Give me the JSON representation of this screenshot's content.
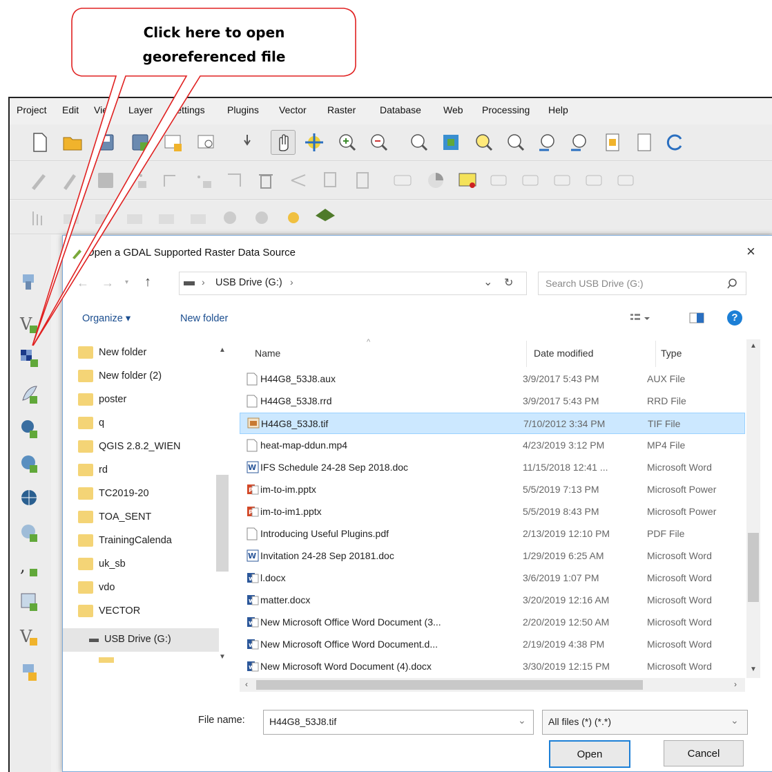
{
  "callout": {
    "line1": "Click here to open",
    "line2": "georeferenced file"
  },
  "menu": [
    "Project",
    "Edit",
    "View",
    "Layer",
    "Settings",
    "Plugins",
    "Vector",
    "Raster",
    "Database",
    "Web",
    "Processing",
    "Help"
  ],
  "dialog": {
    "title": "Open a GDAL Supported Raster Data Source",
    "close_glyph": "×",
    "address": {
      "drive_label": "USB Drive (G:)",
      "separator": "›",
      "dropdown": "⌄"
    },
    "search_placeholder": "Search USB Drive (G:)",
    "organize": "Organize ▾",
    "new_folder": "New folder",
    "nav_items": [
      "New folder",
      "New folder (2)",
      "poster",
      "q",
      "QGIS 2.8.2_WIEN",
      "rd",
      "TC2019-20",
      "TOA_SENT",
      "TrainingCalenda",
      "uk_sb",
      "vdo",
      "VECTOR"
    ],
    "nav_drive": "USB Drive (G:)",
    "columns": {
      "name": "Name",
      "date": "Date modified",
      "type": "Type"
    },
    "files": [
      {
        "name": "H44G8_53J8.aux",
        "date": "3/9/2017 5:43 PM",
        "type": "AUX File",
        "icon": "blank-file-icon"
      },
      {
        "name": "H44G8_53J8.rrd",
        "date": "3/9/2017 5:43 PM",
        "type": "RRD File",
        "icon": "blank-file-icon"
      },
      {
        "name": "H44G8_53J8.tif",
        "date": "7/10/2012 3:34 PM",
        "type": "TIF File",
        "icon": "image-file-icon",
        "selected": true
      },
      {
        "name": "heat-map-ddun.mp4",
        "date": "4/23/2019 3:12 PM",
        "type": "MP4 File",
        "icon": "blank-file-icon"
      },
      {
        "name": "IFS Schedule 24-28 Sep 2018.doc",
        "date": "11/15/2018 12:41 ...",
        "type": "Microsoft Word",
        "icon": "word-doc-icon"
      },
      {
        "name": "im-to-im.pptx",
        "date": "5/5/2019 7:13 PM",
        "type": "Microsoft Power",
        "icon": "powerpoint-icon"
      },
      {
        "name": "im-to-im1.pptx",
        "date": "5/5/2019 8:43 PM",
        "type": "Microsoft Power",
        "icon": "powerpoint-icon"
      },
      {
        "name": "Introducing Useful Plugins.pdf",
        "date": "2/13/2019 12:10 PM",
        "type": "PDF File",
        "icon": "blank-file-icon"
      },
      {
        "name": "Invitation 24-28 Sep 20181.doc",
        "date": "1/29/2019 6:25 AM",
        "type": "Microsoft Word",
        "icon": "word-doc-icon"
      },
      {
        "name": "l.docx",
        "date": "3/6/2019 1:07 PM",
        "type": "Microsoft Word",
        "icon": "word-docx-icon"
      },
      {
        "name": "matter.docx",
        "date": "3/20/2019 12:16 AM",
        "type": "Microsoft Word",
        "icon": "word-docx-icon"
      },
      {
        "name": "New Microsoft Office Word Document (3...",
        "date": "2/20/2019 12:50 AM",
        "type": "Microsoft Word",
        "icon": "word-docx-icon"
      },
      {
        "name": "New Microsoft Office Word Document.d...",
        "date": "2/19/2019 4:38 PM",
        "type": "Microsoft Word",
        "icon": "word-docx-icon"
      },
      {
        "name": "New Microsoft Word Document (4).docx",
        "date": "3/30/2019 12:15 PM",
        "type": "Microsoft Word",
        "icon": "word-docx-icon"
      }
    ],
    "filename_label": "File name:",
    "filename_value": "H44G8_53J8.tif",
    "filter_value": "All files (*) (*.*)",
    "open": "Open",
    "cancel": "Cancel"
  },
  "colors": {
    "accent": "#1c7fd6",
    "selected_row": "#cce8ff",
    "callout_border": "#e02020",
    "folder": "#f4d476"
  }
}
